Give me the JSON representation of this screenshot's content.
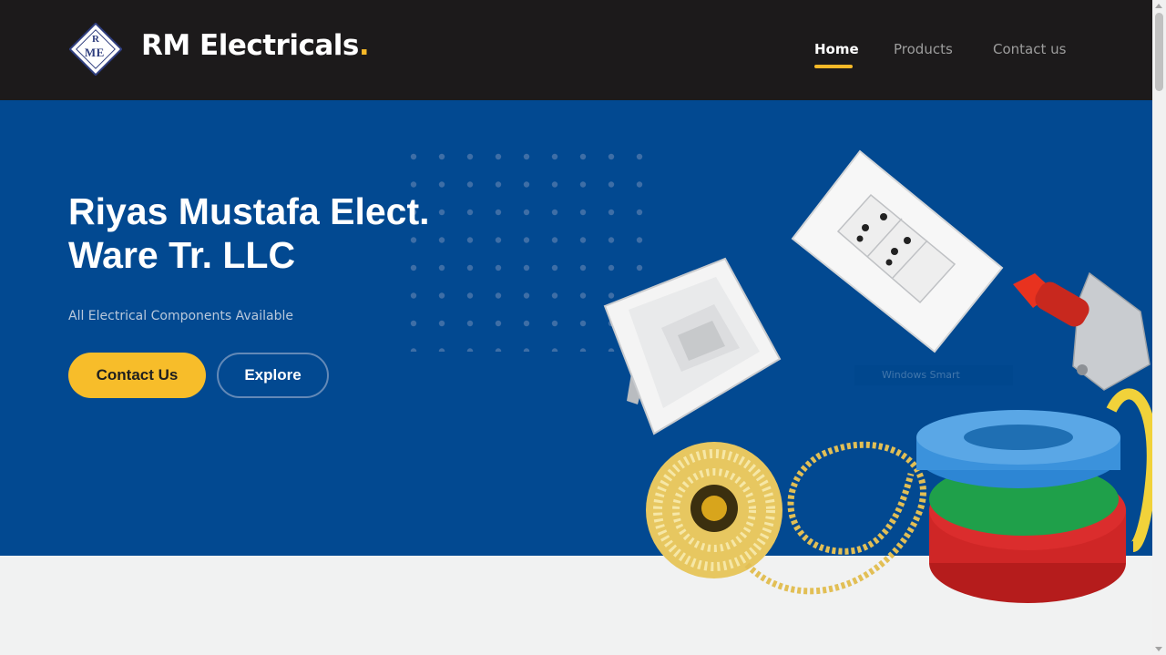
{
  "header": {
    "logo": {
      "mark_letters": [
        "R",
        "M",
        "E"
      ],
      "name": "RM Electricals",
      "name_dot": "."
    },
    "nav": [
      {
        "label": "Home",
        "active": true
      },
      {
        "label": "Products",
        "active": false
      },
      {
        "label": "Contact us",
        "active": false
      }
    ]
  },
  "hero": {
    "title_line1": "Riyas Mustafa Elect.",
    "title_line2": "Ware Tr. LLC",
    "subtitle": "All Electrical Components Available",
    "buttons": {
      "contact": "Contact Us",
      "explore": "Explore"
    },
    "watermark": "Windows Smart"
  },
  "products_image": {
    "icons": [
      "flood-light-icon",
      "wall-socket-icon",
      "push-button-switch-icon",
      "led-strip-icon",
      "wire-coil-icon"
    ]
  },
  "colors": {
    "header_bg": "#1c1a1b",
    "hero_bg": "#024991",
    "accent": "#f7b928",
    "page_bg": "#f1f2f2"
  }
}
